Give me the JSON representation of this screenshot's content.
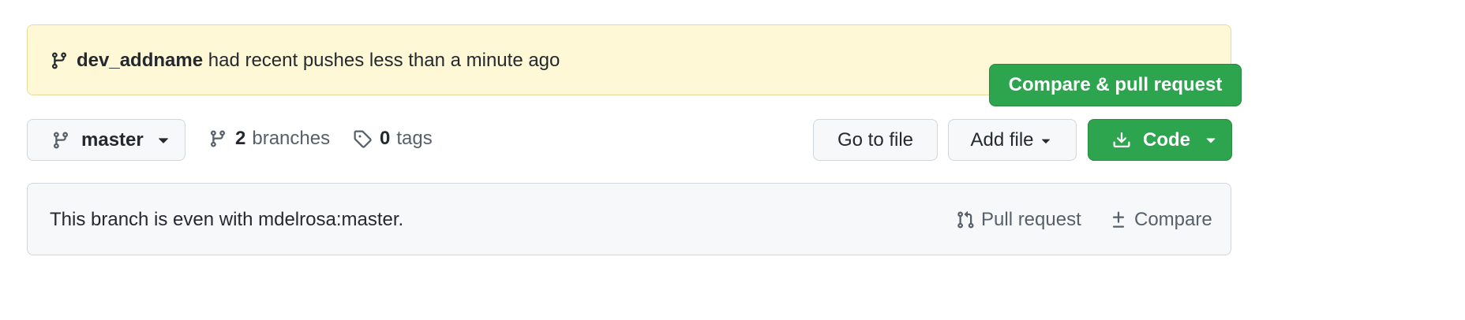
{
  "flash": {
    "branch_name": "dev_addname",
    "message": " had recent pushes less than a minute ago",
    "button_label": "Compare & pull request"
  },
  "branch_bar": {
    "current_branch": "master",
    "branches_count": "2",
    "branches_label": "branches",
    "tags_count": "0",
    "tags_label": "tags",
    "go_to_file_label": "Go to file",
    "add_file_label": "Add file",
    "code_label": "Code"
  },
  "compare_bar": {
    "status_text": "This branch is even with mdelrosa:master.",
    "pull_request_label": "Pull request",
    "compare_label": "Compare"
  },
  "colors": {
    "accent_green": "#2da44e",
    "flash_background": "#fff8d6",
    "muted_text": "#57606a"
  },
  "icons": {
    "branch": "git-branch-icon",
    "tag": "tag-icon",
    "download": "download-icon",
    "caret": "triangle-down-icon",
    "pull_request": "git-pull-request-icon",
    "diff": "diff-icon"
  }
}
